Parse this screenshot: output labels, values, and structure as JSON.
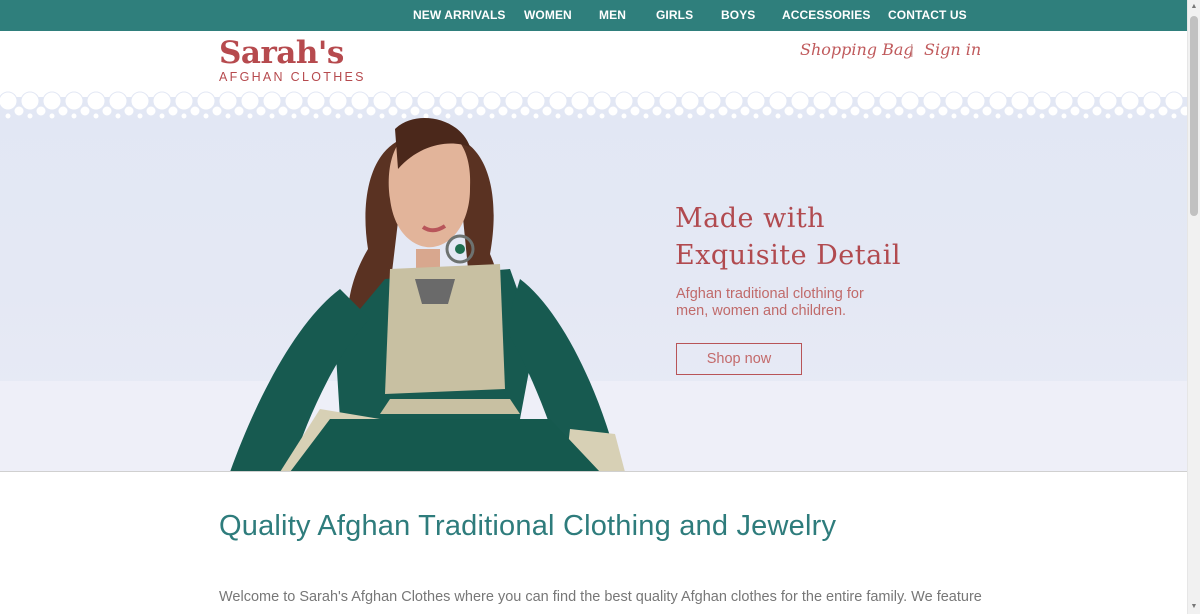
{
  "nav": {
    "items": [
      {
        "label": "NEW ARRIVALS"
      },
      {
        "label": "WOMEN"
      },
      {
        "label": "MEN"
      },
      {
        "label": "GIRLS"
      },
      {
        "label": "BOYS"
      },
      {
        "label": "ACCESSORIES"
      },
      {
        "label": "CONTACT US"
      }
    ]
  },
  "header": {
    "logo_name": "Sarah's",
    "logo_sub": "AFGHAN CLOTHES",
    "shopping_bag": "Shopping Bag",
    "separator": "|",
    "sign_in": "Sign in"
  },
  "hero": {
    "title_line1": "Made with",
    "title_line2": "Exquisite Detail",
    "subtitle": "Afghan traditional clothing for men, women and children.",
    "button": "Shop now"
  },
  "content": {
    "headline": "Quality Afghan Traditional Clothing and Jewelry",
    "intro": "Welcome to Sarah's Afghan Clothes where you can find the best quality Afghan clothes for the entire family. We feature"
  },
  "colors": {
    "nav_bg": "#2f7f7c",
    "brand": "#b64a4e",
    "headline": "#2e7c7c"
  }
}
